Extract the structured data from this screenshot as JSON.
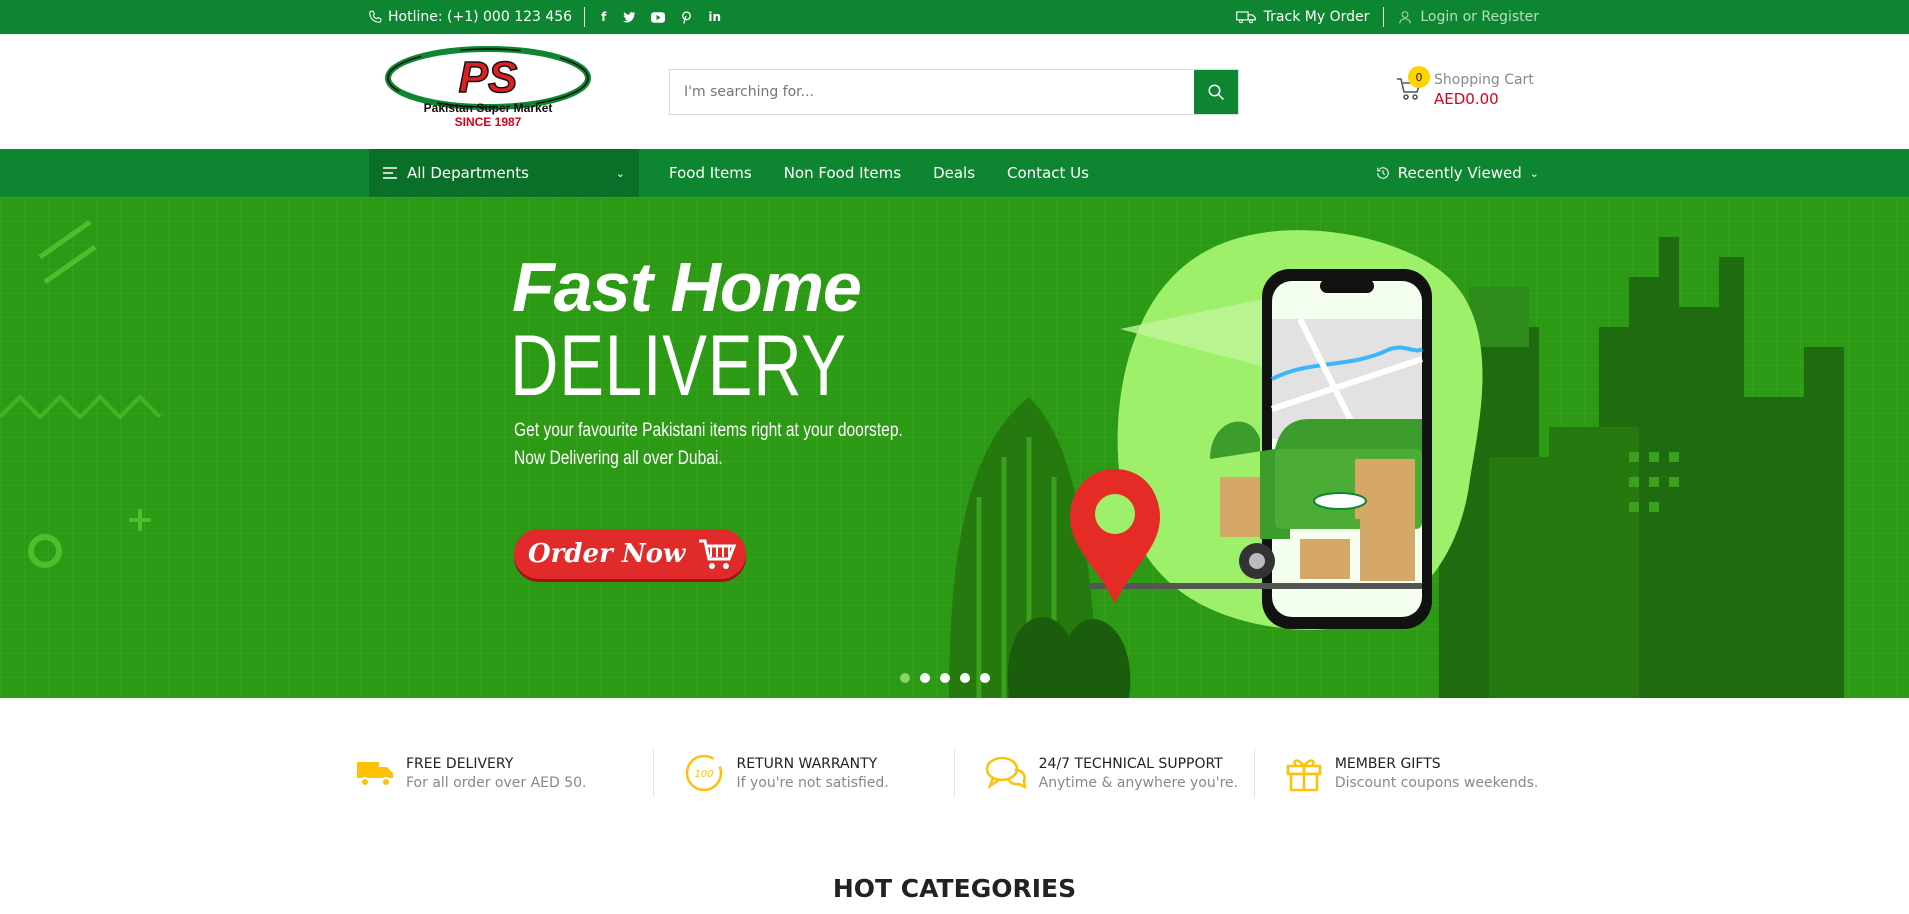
{
  "topbar": {
    "hotline": "Hotline: (+1) 000 123 456",
    "socials": [
      "f",
      "t",
      "yt",
      "p",
      "in"
    ],
    "track_order": "Track My Order",
    "login": "Login or Register"
  },
  "header": {
    "logo": {
      "mark": "PS",
      "name": "Pakistan Super Market",
      "since": "SINCE 1987"
    },
    "search": {
      "placeholder": "I'm searching for..."
    },
    "cart": {
      "count": "0",
      "label": "Shopping Cart",
      "amount": "AED0.00"
    }
  },
  "nav": {
    "departments": "All Departments",
    "items": [
      "Food Items",
      "Non Food Items",
      "Deals",
      "Contact Us"
    ],
    "recently_viewed": "Recently Viewed"
  },
  "hero": {
    "title_line1": "Fast Home",
    "title_line2": "DELIVERY",
    "subtitle_line1": "Get your favourite Pakistani items right at your doorstep.",
    "subtitle_line2": "Now Delivering all over Dubai.",
    "cta": "Order Now",
    "slides": 5,
    "active_slide": 1
  },
  "features": [
    {
      "icon": "truck-icon",
      "title": "FREE DELIVERY",
      "desc": "For all order over AED 50."
    },
    {
      "icon": "warranty-icon",
      "title": "RETURN WARRANTY",
      "desc": "If you're not satisfied."
    },
    {
      "icon": "support-icon",
      "title": "24/7 TECHNICAL SUPPORT",
      "desc": "Anytime & anywhere you're."
    },
    {
      "icon": "gift-icon",
      "title": "MEMBER GIFTS",
      "desc": "Discount coupons weekends."
    }
  ],
  "section_title": "HOT CATEGORIES",
  "colors": {
    "brand_green": "#0e8531",
    "accent_yellow": "#ffd400",
    "price_red": "#d8001c"
  }
}
